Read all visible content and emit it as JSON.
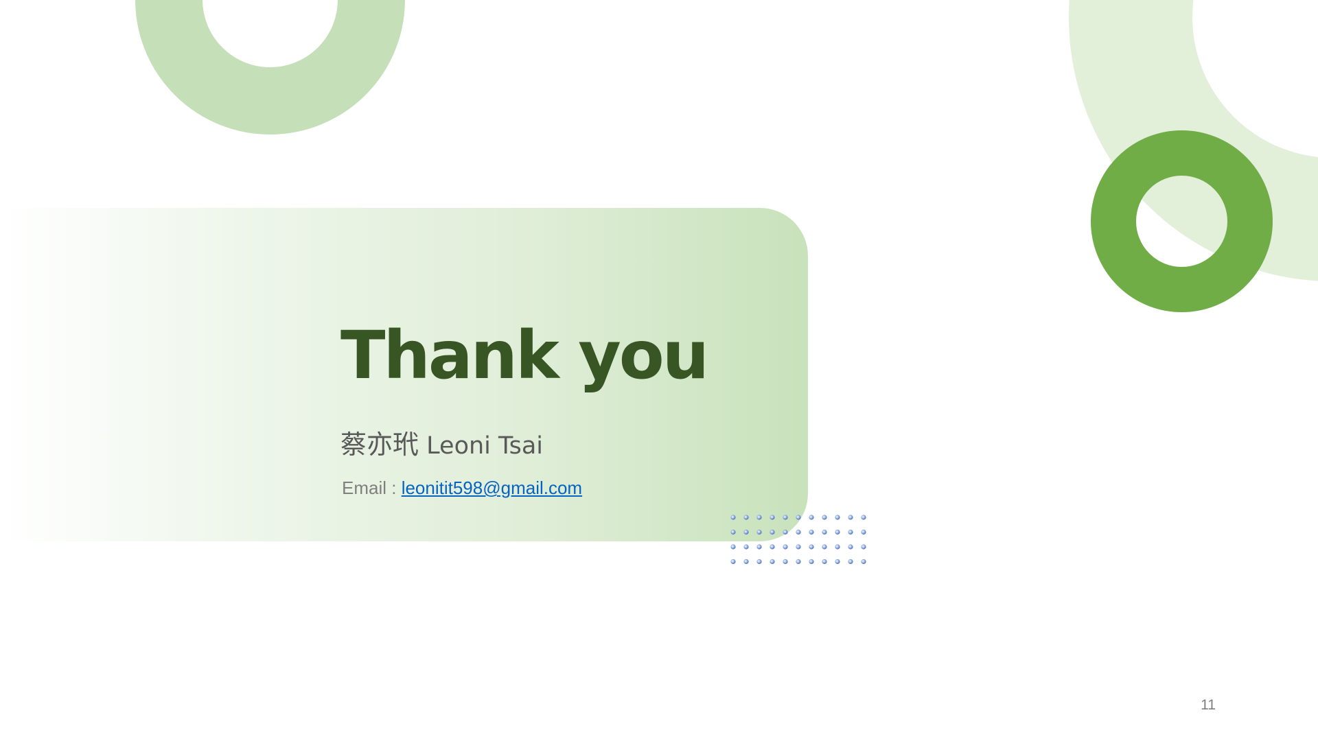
{
  "slide": {
    "title": "Thank you",
    "name_cjk": "蔡亦玳",
    "name_latin": "Leoni Tsai",
    "email_label": "Email : ",
    "email": "leonitit598@gmail.com",
    "page_number": "11"
  },
  "colors": {
    "title": "#375623",
    "ring_light": "#c5e0b9",
    "ring_pale": "#e2efd9",
    "ring_dark": "#70ad47",
    "banner_end": "#c8e2bb",
    "link": "#0563c1",
    "dots": "#4472c4"
  }
}
